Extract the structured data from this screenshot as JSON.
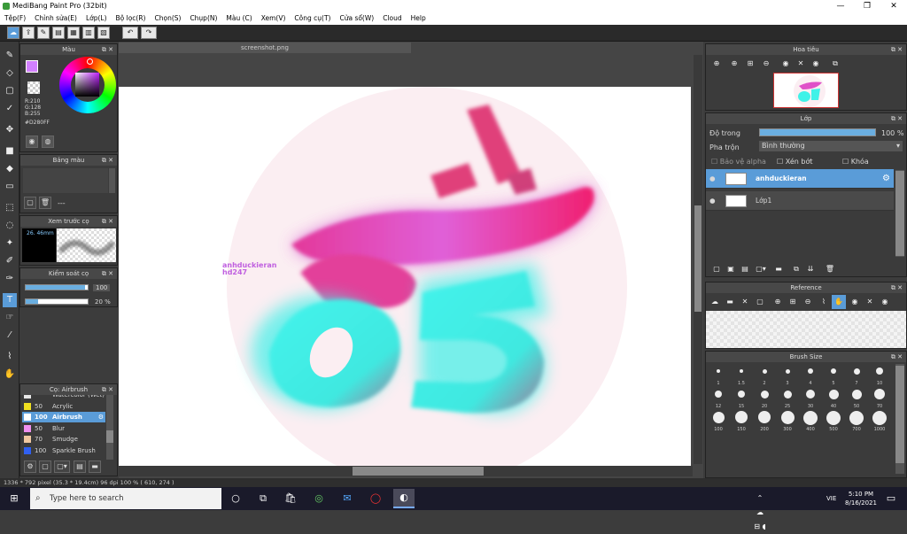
{
  "window": {
    "title": "MediBang Paint Pro (32bit)"
  },
  "menu": [
    "Tệp(F)",
    "Chỉnh sửa(E)",
    "Lớp(L)",
    "Bộ lọc(R)",
    "Chọn(S)",
    "Chụp(N)",
    "Màu (C)",
    "Xem(V)",
    "Công cụ(T)",
    "Cửa sổ(W)",
    "Cloud",
    "Help"
  ],
  "colors": {
    "accent": "#5a9cd8",
    "primary_swatch": "#d280ff",
    "canvas_bg": "#ffffff",
    "teal": "#3ff2e8",
    "pink": "#e050c8"
  },
  "color_panel": {
    "title": "Màu",
    "r": "R:210",
    "g": "G:128",
    "b": "B:255",
    "hex": "#D280FF"
  },
  "palette_panel": {
    "title": "Bảng màu",
    "empty": "---"
  },
  "preview_panel": {
    "title": "Xem trước cọ",
    "size": "26. 46mm"
  },
  "control_panel": {
    "title": "Kiểm soát cọ",
    "size_value": "100",
    "opacity_value": "20 %",
    "size_frac": 0.95,
    "opacity_frac": 0.2
  },
  "brush_panel": {
    "title": "Cọ: Airbrush",
    "items": [
      {
        "size": "",
        "name": "Watercolor (Wet)",
        "color": "#e8e8e8",
        "selected": false
      },
      {
        "size": "50",
        "name": "Acrylic",
        "color": "#f0e020",
        "selected": false
      },
      {
        "size": "100",
        "name": "Airbrush",
        "color": "#ffffff",
        "selected": true
      },
      {
        "size": "50",
        "name": "Blur",
        "color": "#f090f0",
        "selected": false
      },
      {
        "size": "70",
        "name": "Smudge",
        "color": "#f0c8a0",
        "selected": false
      },
      {
        "size": "100",
        "name": "Sparkle Brush",
        "color": "#3060f0",
        "selected": false
      }
    ]
  },
  "document": {
    "tab": "screenshot.png",
    "watermark_line1": "anhduckieran",
    "watermark_line2": "hd247"
  },
  "navigator": {
    "title": "Hoa tiêu"
  },
  "layer_panel": {
    "title": "Lớp",
    "opacity_label": "Độ trong",
    "opacity_value": "100 %",
    "blend_label": "Pha trộn",
    "blend_value": "Bình thường",
    "protect_alpha": "Bảo vệ alpha",
    "clipping": "Xén bớt",
    "lock": "Khóa",
    "layers": [
      {
        "name": "anhduckieran",
        "selected": true
      },
      {
        "name": "Lớp1",
        "selected": false
      }
    ]
  },
  "reference_panel": {
    "title": "Reference"
  },
  "brush_size_panel": {
    "title": "Brush Size",
    "sizes": [
      "1",
      "1.5",
      "2",
      "3",
      "4",
      "5",
      "7",
      "10",
      "12",
      "15",
      "20",
      "25",
      "30",
      "40",
      "50",
      "70",
      "100",
      "150",
      "200",
      "300",
      "400",
      "500",
      "700",
      "1000"
    ]
  },
  "status": "1336 * 792 pixel  (35.3 * 19.4cm)  96 dpi  100 %  ( 610, 274 )",
  "taskbar": {
    "search_placeholder": "Type here to search",
    "time": "5:10 PM",
    "date": "8/16/2021",
    "lang": "VIE"
  }
}
